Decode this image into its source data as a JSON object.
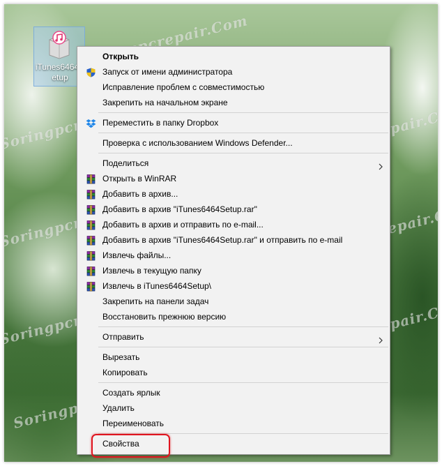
{
  "desktop": {
    "icon_label": "iTunes6464Setup",
    "watermark": "Soringpcrepair.Com"
  },
  "menu": {
    "groups": [
      [
        {
          "label": "Открыть",
          "bold": true,
          "icon": "none"
        },
        {
          "label": "Запуск от имени администратора",
          "icon": "uac-shield-icon"
        },
        {
          "label": "Исправление проблем с совместимостью",
          "icon": "none"
        },
        {
          "label": "Закрепить на начальном экране",
          "icon": "none"
        }
      ],
      [
        {
          "label": "Переместить в папку Dropbox",
          "icon": "dropbox-icon"
        }
      ],
      [
        {
          "label": "Проверка с использованием Windows Defender...",
          "icon": "none"
        }
      ],
      [
        {
          "label": "Поделиться",
          "icon": "none",
          "submenu": true
        },
        {
          "label": "Открыть в WinRAR",
          "icon": "winrar-icon"
        },
        {
          "label": "Добавить в архив...",
          "icon": "winrar-icon"
        },
        {
          "label": "Добавить в архив \"iTunes6464Setup.rar\"",
          "icon": "winrar-icon"
        },
        {
          "label": "Добавить в архив и отправить по e-mail...",
          "icon": "winrar-icon"
        },
        {
          "label": "Добавить в архив \"iTunes6464Setup.rar\" и отправить по e-mail",
          "icon": "winrar-icon"
        },
        {
          "label": "Извлечь файлы...",
          "icon": "winrar-icon"
        },
        {
          "label": "Извлечь в текущую папку",
          "icon": "winrar-icon"
        },
        {
          "label": "Извлечь в iTunes6464Setup\\",
          "icon": "winrar-icon"
        },
        {
          "label": "Закрепить на панели задач",
          "icon": "none"
        },
        {
          "label": "Восстановить прежнюю версию",
          "icon": "none"
        }
      ],
      [
        {
          "label": "Отправить",
          "icon": "none",
          "submenu": true
        }
      ],
      [
        {
          "label": "Вырезать",
          "icon": "none"
        },
        {
          "label": "Копировать",
          "icon": "none"
        }
      ],
      [
        {
          "label": "Создать ярлык",
          "icon": "none"
        },
        {
          "label": "Удалить",
          "icon": "none"
        },
        {
          "label": "Переименовать",
          "icon": "none"
        }
      ],
      [
        {
          "label": "Свойства",
          "icon": "none",
          "highlighted": true
        }
      ]
    ]
  },
  "colors": {
    "menu_bg": "#f2f2f2",
    "separator": "#d2d2d2",
    "highlight_border": "#e0141e"
  }
}
